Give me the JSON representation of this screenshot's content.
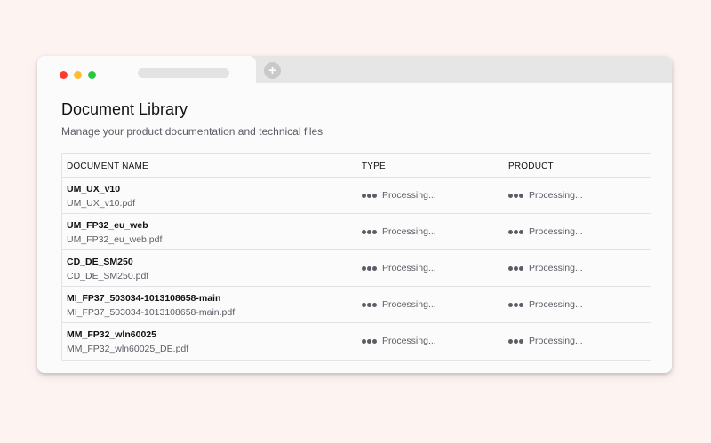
{
  "browser": {
    "new_tab_label": "+"
  },
  "page": {
    "title": "Document Library",
    "subtitle": "Manage your product documentation and technical files"
  },
  "table": {
    "columns": [
      "DOCUMENT NAME",
      "TYPE",
      "PRODUCT"
    ],
    "rows": [
      {
        "name": "UM_UX_v10",
        "file": "UM_UX_v10.pdf",
        "type_status": "Processing...",
        "product_status": "Processing..."
      },
      {
        "name": "UM_FP32_eu_web",
        "file": "UM_FP32_eu_web.pdf",
        "type_status": "Processing...",
        "product_status": "Processing..."
      },
      {
        "name": "CD_DE_SM250",
        "file": "CD_DE_SM250.pdf",
        "type_status": "Processing...",
        "product_status": "Processing..."
      },
      {
        "name": "MI_FP37_503034-1013108658-main",
        "file": "MI_FP37_503034-1013108658-main.pdf",
        "type_status": "Processing...",
        "product_status": "Processing..."
      },
      {
        "name": "MM_FP32_wln60025",
        "file": "MM_FP32_wln60025_DE.pdf",
        "type_status": "Processing...",
        "product_status": "Processing..."
      }
    ]
  },
  "colors": {
    "background": "#fdf3f1",
    "close": "#ff3b30",
    "minimize": "#ffbd2e",
    "maximize": "#28c840"
  }
}
